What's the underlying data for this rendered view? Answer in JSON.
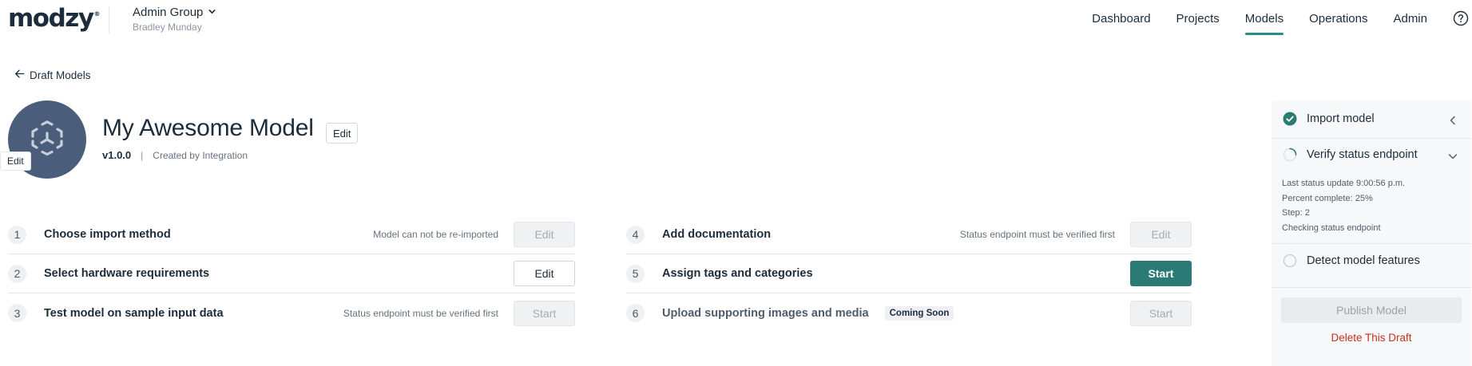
{
  "app": {
    "logo": "modzy",
    "logo_mark": "®"
  },
  "header": {
    "group_name": "Admin Group",
    "group_user": "Bradley Munday",
    "nav": [
      "Dashboard",
      "Projects",
      "Models",
      "Operations",
      "Admin"
    ],
    "active_nav": "Models",
    "help_icon": "question-circle-icon"
  },
  "breadcrumb": {
    "back_label": "Draft Models"
  },
  "model": {
    "title": "My Awesome Model",
    "edit_label": "Edit",
    "avatar_edit_label": "Edit",
    "version": "v1.0.0",
    "separator": "|",
    "created_by": "Created by Integration",
    "avatar_color": "#4a5e7b"
  },
  "steps_left": [
    {
      "number": "1",
      "label": "Choose import method",
      "note": "Model can not be re-imported",
      "button": "Edit",
      "state": "disabled"
    },
    {
      "number": "2",
      "label": "Select hardware requirements",
      "note": "",
      "button": "Edit",
      "state": "outline"
    },
    {
      "number": "3",
      "label": "Test model on sample input data",
      "note": "Status endpoint must be verified first",
      "button": "Start",
      "state": "disabled"
    }
  ],
  "steps_right": [
    {
      "number": "4",
      "label": "Add documentation",
      "note": "Status endpoint must be verified first",
      "button": "Edit",
      "state": "disabled"
    },
    {
      "number": "5",
      "label": "Assign tags and categories",
      "note": "",
      "button": "Start",
      "state": "primary"
    },
    {
      "number": "6",
      "label": "Upload supporting images and media",
      "badge": "Coming Soon",
      "note": "",
      "button": "Start",
      "state": "disabled"
    }
  ],
  "panel": {
    "items": [
      {
        "label": "Import model",
        "status": "complete"
      },
      {
        "label": "Verify status endpoint",
        "status": "in-progress"
      },
      {
        "label": "Detect model features",
        "status": "pending"
      }
    ],
    "status_lines": [
      "Last status update 9:00:56 p.m.",
      "Percent complete: 25%",
      "Step: 2",
      "Checking status endpoint"
    ],
    "percent_complete": 25,
    "publish_label": "Publish Model",
    "delete_label": "Delete This Draft"
  },
  "colors": {
    "accent": "#2a8c88",
    "primary_button": "#2a7a76",
    "danger": "#c1321f"
  }
}
